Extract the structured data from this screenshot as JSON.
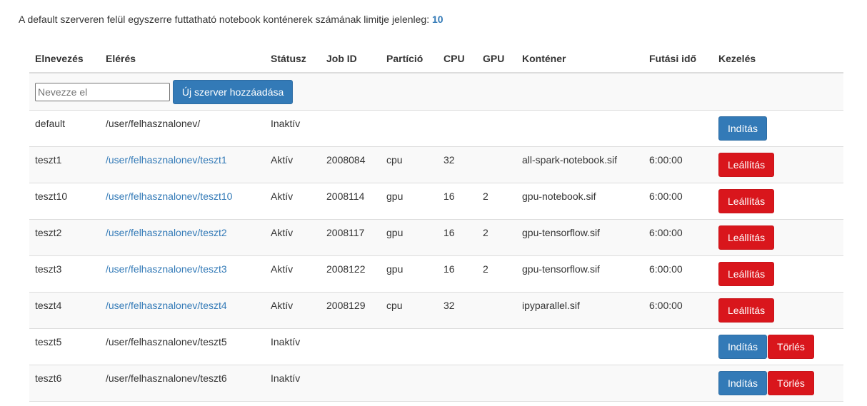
{
  "notice": {
    "text": "A default szerveren felül egyszerre futtatható notebook konténerek számának limitje jelenleg: ",
    "limit": "10"
  },
  "table": {
    "headers": [
      "Elnevezés",
      "Elérés",
      "Státusz",
      "Job ID",
      "Partíció",
      "CPU",
      "GPU",
      "Konténer",
      "Futási idő",
      "Kezelés"
    ],
    "add_row": {
      "placeholder": "Nevezze el",
      "value": "",
      "add_button_label": "Új szerver hozzáadása"
    },
    "labels": {
      "start": "Indítás",
      "stop": "Leállítás",
      "delete": "Törlés"
    },
    "rows": [
      {
        "name": "default",
        "path": "/user/felhasznalonev/",
        "status": "Inaktív",
        "job_id": "",
        "partition": "",
        "cpu": "",
        "gpu": "",
        "container": "",
        "runtime": ""
      },
      {
        "name": "teszt1",
        "path": "/user/felhasznalonev/teszt1",
        "status": "Aktív",
        "job_id": "2008084",
        "partition": "cpu",
        "cpu": "32",
        "gpu": "",
        "container": "all-spark-notebook.sif",
        "runtime": "6:00:00"
      },
      {
        "name": "teszt10",
        "path": "/user/felhasznalonev/teszt10",
        "status": "Aktív",
        "job_id": "2008114",
        "partition": "gpu",
        "cpu": "16",
        "gpu": "2",
        "container": "gpu-notebook.sif",
        "runtime": "6:00:00"
      },
      {
        "name": "teszt2",
        "path": "/user/felhasznalonev/teszt2",
        "status": "Aktív",
        "job_id": "2008117",
        "partition": "gpu",
        "cpu": "16",
        "gpu": "2",
        "container": "gpu-tensorflow.sif",
        "runtime": "6:00:00"
      },
      {
        "name": "teszt3",
        "path": "/user/felhasznalonev/teszt3",
        "status": "Aktív",
        "job_id": "2008122",
        "partition": "gpu",
        "cpu": "16",
        "gpu": "2",
        "container": "gpu-tensorflow.sif",
        "runtime": "6:00:00"
      },
      {
        "name": "teszt4",
        "path": "/user/felhasznalonev/teszt4",
        "status": "Aktív",
        "job_id": "2008129",
        "partition": "cpu",
        "cpu": "32",
        "gpu": "",
        "container": "ipyparallel.sif",
        "runtime": "6:00:00"
      },
      {
        "name": "teszt5",
        "path": "/user/felhasznalonev/teszt5",
        "status": "Inaktív",
        "job_id": "",
        "partition": "",
        "cpu": "",
        "gpu": "",
        "container": "",
        "runtime": ""
      },
      {
        "name": "teszt6",
        "path": "/user/felhasznalonev/teszt6",
        "status": "Inaktív",
        "job_id": "",
        "partition": "",
        "cpu": "",
        "gpu": "",
        "container": "",
        "runtime": ""
      }
    ]
  },
  "colors": {
    "link": "#337ab7",
    "primary_button": "#337ab7",
    "danger_button": "#d9161c",
    "stripe": "#f9f9f9",
    "border": "#dddddd"
  }
}
